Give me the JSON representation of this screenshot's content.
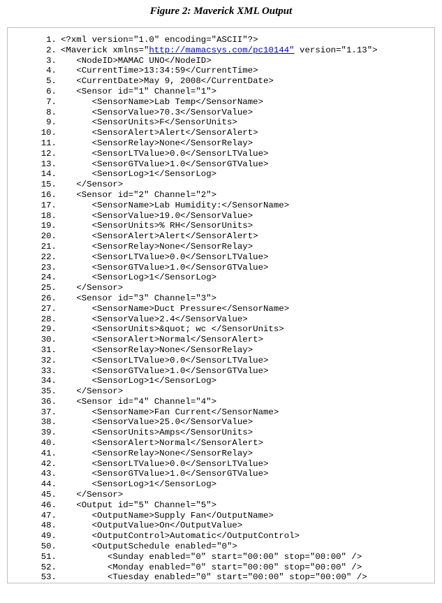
{
  "title": "Figure 2: Maverick XML Output",
  "xml_link_text": "http://mamacsys.com/pc10144",
  "chart_data": {
    "type": "table",
    "title": "Maverick XML Output",
    "NodeID": "MAMAC UNO",
    "CurrentTime": "13:34:59",
    "CurrentDate": "May 9, 2008",
    "namespace": "http://mamacsys.com/pc10144",
    "version": "1.13",
    "sensors": [
      {
        "id": "1",
        "Channel": "1",
        "SensorName": "Lab Temp",
        "SensorValue": "70.3",
        "SensorUnits": "F",
        "SensorAlert": "Alert",
        "SensorRelay": "None",
        "SensorLTValue": "0.0",
        "SensorGTValue": "1.0",
        "SensorLog": "1"
      },
      {
        "id": "2",
        "Channel": "2",
        "SensorName": "Lab Humidity:",
        "SensorValue": "19.0",
        "SensorUnits": "% RH",
        "SensorAlert": "Alert",
        "SensorRelay": "None",
        "SensorLTValue": "0.0",
        "SensorGTValue": "1.0",
        "SensorLog": "1"
      },
      {
        "id": "3",
        "Channel": "3",
        "SensorName": "Duct Pressure",
        "SensorValue": "2.4",
        "SensorUnits": "&quot; wc ",
        "SensorAlert": "Normal",
        "SensorRelay": "None",
        "SensorLTValue": "0.0",
        "SensorGTValue": "1.0",
        "SensorLog": "1"
      },
      {
        "id": "4",
        "Channel": "4",
        "SensorName": "Fan Current",
        "SensorValue": "25.0",
        "SensorUnits": "Amps",
        "SensorAlert": "Normal",
        "SensorRelay": "None",
        "SensorLTValue": "0.0",
        "SensorGTValue": "1.0",
        "SensorLog": "1"
      }
    ],
    "output": {
      "id": "5",
      "Channel": "5",
      "OutputName": "Supply Fan",
      "OutputValue": "On",
      "OutputControl": "Automatic",
      "schedule_enabled": "0",
      "days": [
        {
          "name": "Sunday",
          "enabled": "0",
          "start": "00:00",
          "stop": "00:00"
        },
        {
          "name": "Monday",
          "enabled": "0",
          "start": "00:00",
          "stop": "00:00"
        },
        {
          "name": "Tuesday",
          "enabled": "0",
          "start": "00:00",
          "stop": "00:00"
        }
      ]
    }
  },
  "lines": [
    {
      "n": "1.",
      "i": 0,
      "t": "<?xml version=\"1.0\" encoding=\"ASCII\"?>"
    },
    {
      "n": "2.",
      "i": 0,
      "pre": "<Maverick xmlns=\"",
      "link": "http://mamacsys.com/pc10144\"",
      "post": " version=\"1.13\">"
    },
    {
      "n": "3.",
      "i": 1,
      "t": "<NodeID>MAMAC UNO</NodeID>"
    },
    {
      "n": "4.",
      "i": 1,
      "t": "<CurrentTime>13:34:59</CurrentTime>"
    },
    {
      "n": "5.",
      "i": 1,
      "t": "<CurrentDate>May 9, 2008</CurrentDate>"
    },
    {
      "n": "6.",
      "i": 1,
      "t": "<Sensor id=\"1\" Channel=\"1\">"
    },
    {
      "n": "7.",
      "i": 2,
      "t": "<SensorName>Lab Temp</SensorName>"
    },
    {
      "n": "8.",
      "i": 2,
      "t": "<SensorValue>70.3</SensorValue>"
    },
    {
      "n": "9.",
      "i": 2,
      "t": "<SensorUnits>F</SensorUnits>"
    },
    {
      "n": "10.",
      "i": 2,
      "t": "<SensorAlert>Alert</SensorAlert>"
    },
    {
      "n": "11.",
      "i": 2,
      "t": "<SensorRelay>None</SensorRelay>"
    },
    {
      "n": "12.",
      "i": 2,
      "t": "<SensorLTValue>0.0</SensorLTValue>"
    },
    {
      "n": "13.",
      "i": 2,
      "t": "<SensorGTValue>1.0</SensorGTValue>"
    },
    {
      "n": "14.",
      "i": 2,
      "t": "<SensorLog>1</SensorLog>"
    },
    {
      "n": "15.",
      "i": 1,
      "t": "</Sensor>"
    },
    {
      "n": "16.",
      "i": 1,
      "t": "<Sensor id=\"2\" Channel=\"2\">"
    },
    {
      "n": "17.",
      "i": 2,
      "t": "<SensorName>Lab Humidity:</SensorName>"
    },
    {
      "n": "18.",
      "i": 2,
      "t": "<SensorValue>19.0</SensorValue>"
    },
    {
      "n": "19.",
      "i": 2,
      "t": "<SensorUnits>% RH</SensorUnits>"
    },
    {
      "n": "20.",
      "i": 2,
      "t": "<SensorAlert>Alert</SensorAlert>"
    },
    {
      "n": "21.",
      "i": 2,
      "t": "<SensorRelay>None</SensorRelay>"
    },
    {
      "n": "22.",
      "i": 2,
      "t": "<SensorLTValue>0.0</SensorLTValue>"
    },
    {
      "n": "23.",
      "i": 2,
      "t": "<SensorGTValue>1.0</SensorGTValue>"
    },
    {
      "n": "24.",
      "i": 2,
      "t": "<SensorLog>1</SensorLog>"
    },
    {
      "n": "25.",
      "i": 1,
      "t": "</Sensor>"
    },
    {
      "n": "26.",
      "i": 1,
      "t": "<Sensor id=\"3\" Channel=\"3\">"
    },
    {
      "n": "27.",
      "i": 2,
      "t": "<SensorName>Duct Pressure</SensorName>"
    },
    {
      "n": "28.",
      "i": 2,
      "t": "<SensorValue>2.4</SensorValue>"
    },
    {
      "n": "29.",
      "i": 2,
      "t": "<SensorUnits>&quot; wc </SensorUnits>"
    },
    {
      "n": "30.",
      "i": 2,
      "t": "<SensorAlert>Normal</SensorAlert>"
    },
    {
      "n": "31.",
      "i": 2,
      "t": "<SensorRelay>None</SensorRelay>"
    },
    {
      "n": "32.",
      "i": 2,
      "t": "<SensorLTValue>0.0</SensorLTValue>"
    },
    {
      "n": "33.",
      "i": 2,
      "t": "<SensorGTValue>1.0</SensorGTValue>"
    },
    {
      "n": "34.",
      "i": 2,
      "t": "<SensorLog>1</SensorLog>"
    },
    {
      "n": "35.",
      "i": 1,
      "t": "</Sensor>"
    },
    {
      "n": "36.",
      "i": 1,
      "t": "<Sensor id=\"4\" Channel=\"4\">"
    },
    {
      "n": "37.",
      "i": 2,
      "t": "<SensorName>Fan Current</SensorName>"
    },
    {
      "n": "38.",
      "i": 2,
      "t": "<SensorValue>25.0</SensorValue>"
    },
    {
      "n": "39.",
      "i": 2,
      "t": "<SensorUnits>Amps</SensorUnits>"
    },
    {
      "n": "40.",
      "i": 2,
      "t": "<SensorAlert>Normal</SensorAlert>"
    },
    {
      "n": "41.",
      "i": 2,
      "t": "<SensorRelay>None</SensorRelay>"
    },
    {
      "n": "42.",
      "i": 2,
      "t": "<SensorLTValue>0.0</SensorLTValue>"
    },
    {
      "n": "43.",
      "i": 2,
      "t": "<SensorGTValue>1.0</SensorGTValue>"
    },
    {
      "n": "44.",
      "i": 2,
      "t": "<SensorLog>1</SensorLog>"
    },
    {
      "n": "45.",
      "i": 1,
      "t": "</Sensor>"
    },
    {
      "n": "46.",
      "i": 1,
      "t": "<Output id=\"5\" Channel=\"5\">"
    },
    {
      "n": "47.",
      "i": 2,
      "t": "<OutputName>Supply Fan</OutputName>"
    },
    {
      "n": "48.",
      "i": 2,
      "t": "<OutputValue>On</OutputValue>"
    },
    {
      "n": "49.",
      "i": 2,
      "t": "<OutputControl>Automatic</OutputControl>"
    },
    {
      "n": "50.",
      "i": 2,
      "t": "<OutputSchedule enabled=\"0\">"
    },
    {
      "n": "51.",
      "i": 3,
      "t": "<Sunday enabled=\"0\" start=\"00:00\" stop=\"00:00\" />"
    },
    {
      "n": "52.",
      "i": 3,
      "t": "<Monday enabled=\"0\" start=\"00:00\" stop=\"00:00\" />"
    },
    {
      "n": "53.",
      "i": 3,
      "t": "<Tuesday enabled=\"0\" start=\"00:00\" stop=\"00:00\" />"
    }
  ]
}
